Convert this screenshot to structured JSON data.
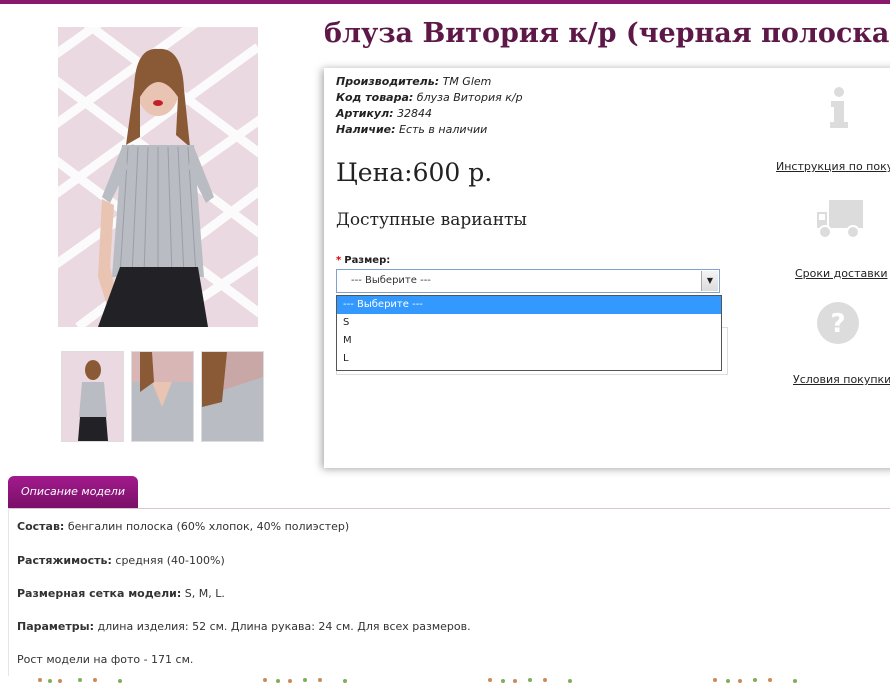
{
  "product": {
    "title": "блуза Витория к/р (черная полоска)",
    "meta": {
      "manufacturer_label": "Производитель:",
      "manufacturer": "ТМ Glem",
      "code_label": "Код товара:",
      "code": "блуза Витория к/р",
      "article_label": "Артикул:",
      "article": "32844",
      "availability_label": "Наличие:",
      "availability": "Есть в наличии"
    },
    "price": "Цена:600 р.",
    "variants_heading": "Доступные варианты",
    "size": {
      "required_mark": "*",
      "label": "Размер:",
      "selected": "--- Выберите ---",
      "options": [
        "--- Выберите ---",
        "S",
        "M",
        "L"
      ]
    }
  },
  "sidebar": {
    "instruction_link": "Инструкция по покупке",
    "delivery_link": "Сроки доставки",
    "terms_link": "Условия покупки"
  },
  "description": {
    "tab_label": "Описание модели",
    "composition_label": "Состав:",
    "composition": "бенгалин полоска (60% хлопок, 40% полиэстер)",
    "stretch_label": "Растяжимость:",
    "stretch": "средняя (40-100%)",
    "sizes_label": "Размерная сетка модели:",
    "sizes": "S, M, L.",
    "params_label": "Параметры:",
    "params": "длина изделия: 52 см. Длина рукава: 24 см. Для всех размеров.",
    "model_height": "Рост модели на фото - 171 см."
  },
  "colors": {
    "brand": "#8a1a6e",
    "title": "#5d1848",
    "tab": "#a21a8d",
    "select_highlight": "#3399ff"
  }
}
